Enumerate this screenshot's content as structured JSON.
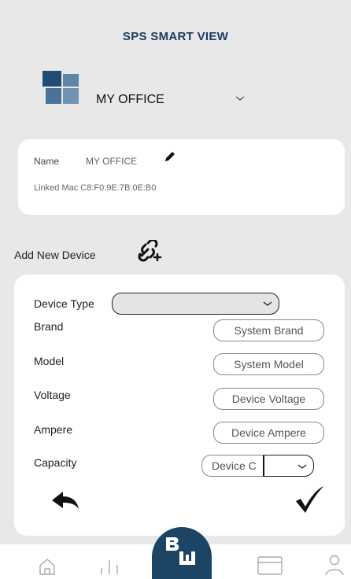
{
  "header": {
    "title": "SPS SMART VIEW"
  },
  "site": {
    "name": "MY OFFICE"
  },
  "info_card": {
    "name_label": "Name",
    "name_value": "MY OFFICE",
    "linked_mac": "Linked Mac C8:F0:9E:7B:0E:B0"
  },
  "add_device": {
    "label": "Add New Device"
  },
  "form": {
    "device_type_label": "Device Type",
    "device_type_value": "",
    "brand_label": "Brand",
    "brand_placeholder": "System Brand",
    "model_label": "Model",
    "model_placeholder": "System Model",
    "voltage_label": "Voltage",
    "voltage_placeholder": "Device Voltage",
    "ampere_label": "Ampere",
    "ampere_placeholder": "Device Ampere",
    "capacity_label": "Capacity",
    "capacity_placeholder": "Device C",
    "capacity_unit": ""
  },
  "nav": {
    "items": [
      "home-icon",
      "chart-icon",
      "brand-logo",
      "card-icon",
      "user-icon"
    ]
  },
  "colors": {
    "accent": "#1c4465",
    "title": "#1d3a5f",
    "background": "#e8e8e8"
  }
}
